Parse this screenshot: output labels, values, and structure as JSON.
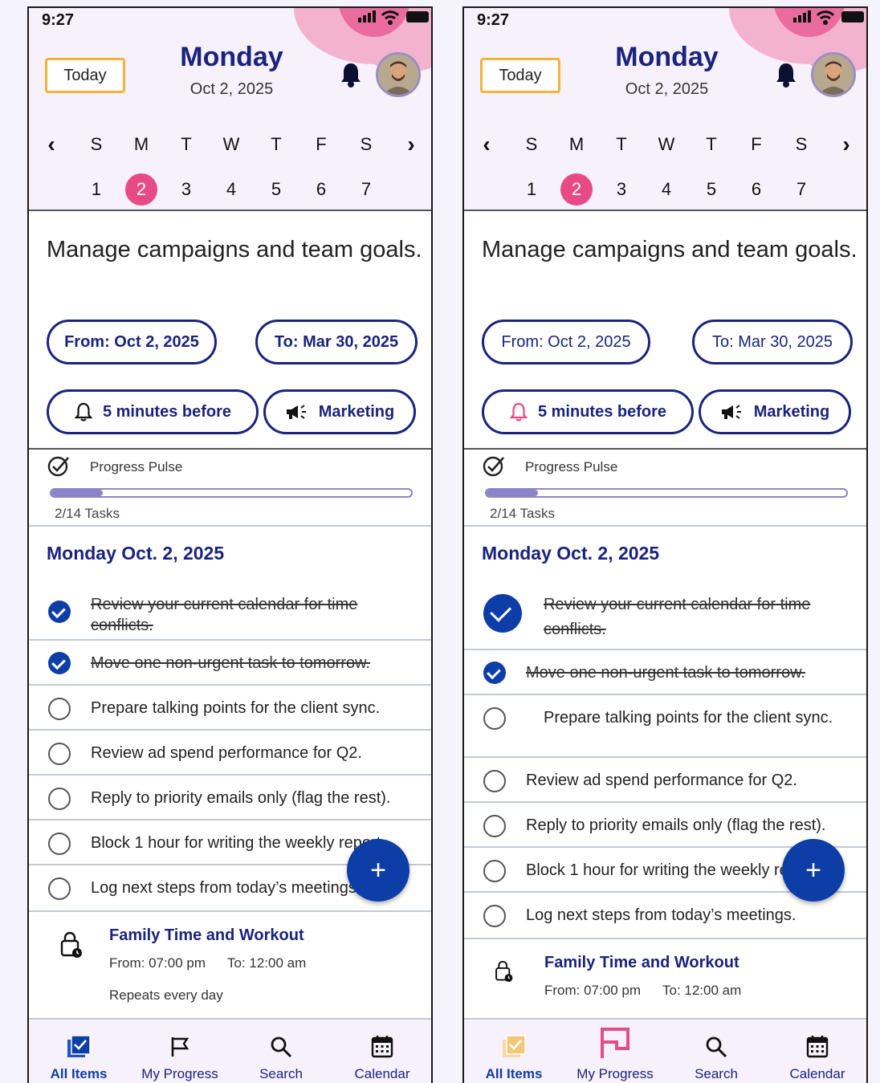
{
  "status": {
    "time": "9:27"
  },
  "header": {
    "today_label": "Today",
    "day_name": "Monday",
    "date": "Oct 2, 2025"
  },
  "week": {
    "days": [
      "S",
      "M",
      "T",
      "W",
      "T",
      "F",
      "S"
    ],
    "dates": [
      "1",
      "2",
      "3",
      "4",
      "5",
      "6",
      "7"
    ],
    "selected": "2",
    "prev": "‹",
    "next": "›"
  },
  "task": {
    "title": "Manage campaigns and team goals.",
    "from": "From: Oct 2, 2025",
    "to": "To: Mar 30, 2025",
    "reminder": "5 minutes before",
    "category": "Marketing"
  },
  "progress": {
    "label": "Progress Pulse",
    "done": 2,
    "total": 14,
    "text": "2/14 Tasks"
  },
  "list": {
    "date_heading": "Monday Oct. 2, 2025",
    "items": [
      {
        "text": "Review your current calendar for time conflicts.",
        "done": true
      },
      {
        "text": "Move one non-urgent task to tomorrow.",
        "done": true
      },
      {
        "text": "Prepare talking points for the client sync.",
        "done": false
      },
      {
        "text": "Review ad spend performance for Q2.",
        "done": false
      },
      {
        "text": "Reply to priority emails only (flag the rest).",
        "done": false
      },
      {
        "text": "Block 1 hour for writing the weekly report.",
        "done": false
      },
      {
        "text": "Log next steps from today’s meetings.",
        "done": false
      }
    ]
  },
  "event": {
    "title": "Family Time and Workout",
    "from": "From: 07:00 pm",
    "to": "To: 12:00 am",
    "repeat": "Repeats every day"
  },
  "fab": {
    "symbol": "+"
  },
  "nav": {
    "all_items": "All Items",
    "my_progress": "My Progress",
    "search": "Search",
    "calendar": "Calendar"
  },
  "colors": {
    "accent": "#1a237e",
    "primary": "#0d3ea8",
    "pink": "#e84a86",
    "today_border": "#f0b43c",
    "reminder_bell_right": "#e84a86"
  }
}
